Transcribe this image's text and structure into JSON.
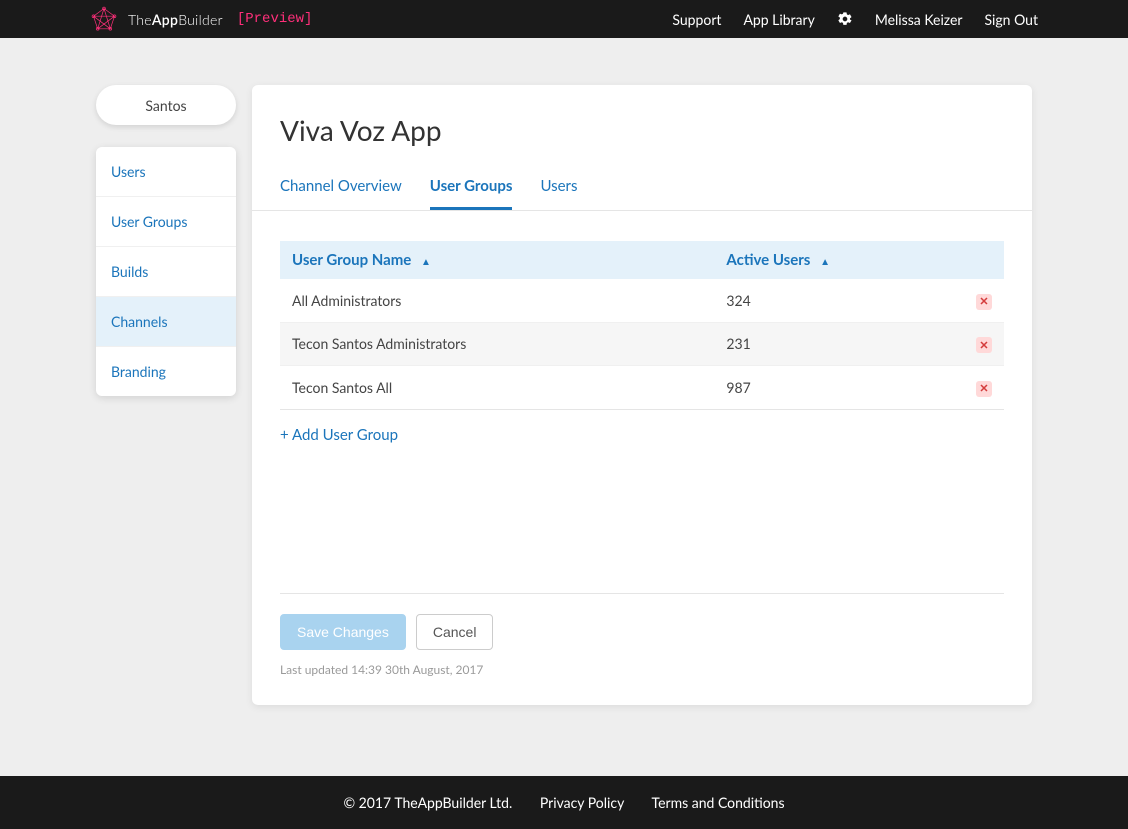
{
  "header": {
    "brand_the": "The",
    "brand_app": "App",
    "brand_builder": "Builder",
    "preview": "[Preview]",
    "nav": {
      "support": "Support",
      "app_library": "App Library",
      "user_name": "Melissa Keizer",
      "sign_out": "Sign Out"
    }
  },
  "sidebar": {
    "org_name": "Santos",
    "items": [
      {
        "label": "Users"
      },
      {
        "label": "User Groups"
      },
      {
        "label": "Builds"
      },
      {
        "label": "Channels"
      },
      {
        "label": "Branding"
      }
    ]
  },
  "main": {
    "title": "Viva Voz App",
    "tabs": [
      {
        "label": "Channel Overview"
      },
      {
        "label": "User Groups"
      },
      {
        "label": "Users"
      }
    ],
    "table": {
      "col_name": "User Group Name",
      "col_users": "Active Users",
      "rows": [
        {
          "name": "All Administrators",
          "users": "324"
        },
        {
          "name": "Tecon Santos Administrators",
          "users": "231"
        },
        {
          "name": "Tecon Santos All",
          "users": "987"
        }
      ]
    },
    "add_link": "+ Add User Group",
    "save_label": "Save Changes",
    "cancel_label": "Cancel",
    "last_updated": "Last updated 14:39 30th August, 2017"
  },
  "footer": {
    "copyright": "© 2017 TheAppBuilder Ltd.",
    "privacy": "Privacy Policy",
    "terms": "Terms and Conditions"
  }
}
